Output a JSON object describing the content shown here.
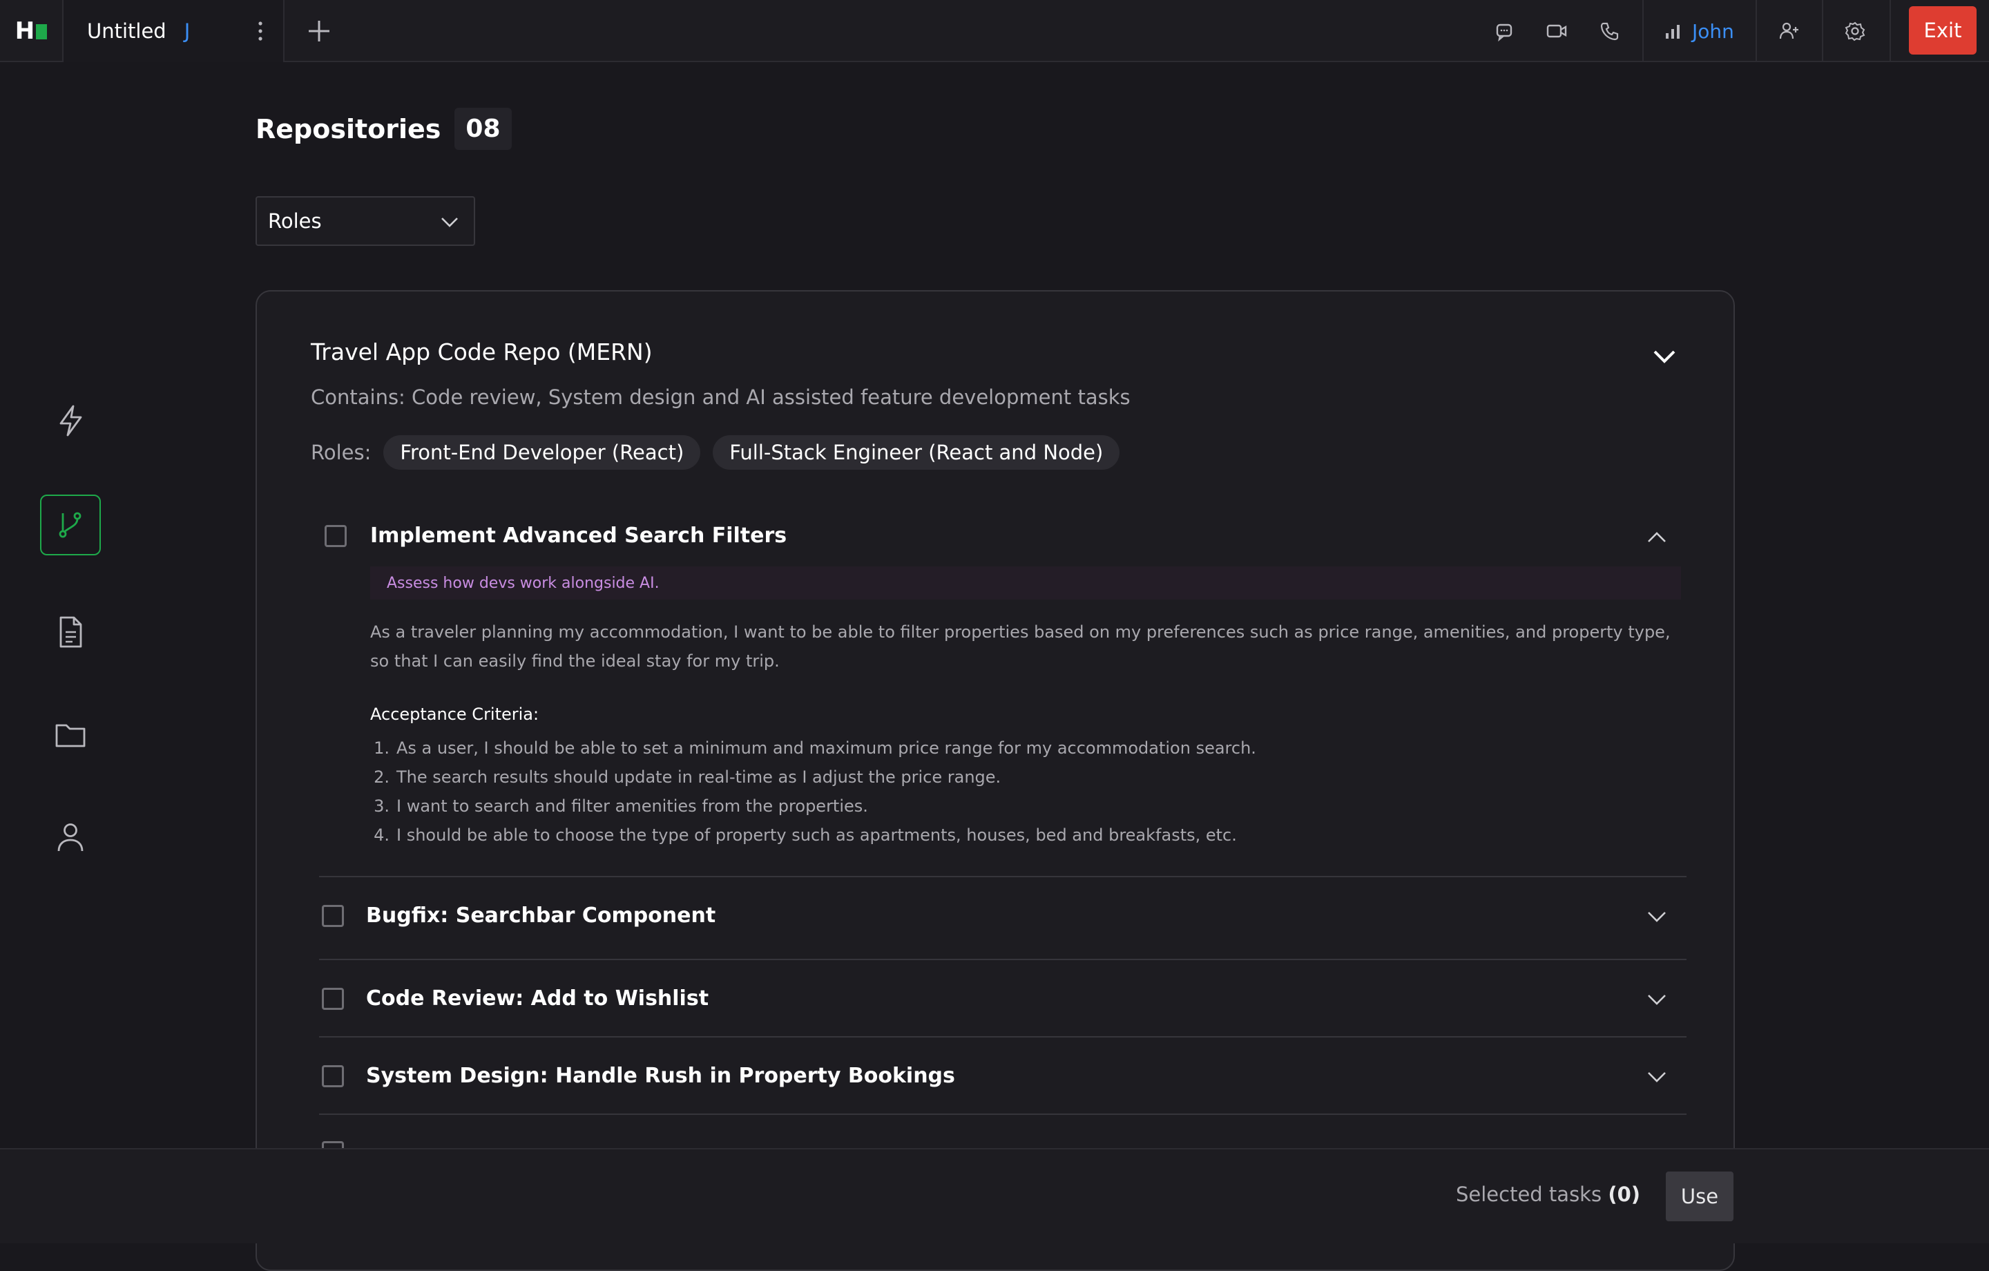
{
  "app": {
    "logo_letter": "H",
    "tab_title": "Untitled",
    "tab_initial": "J",
    "user_name": "John",
    "exit_label": "Exit"
  },
  "page": {
    "title": "Repositories",
    "count": "08",
    "roles_filter": "Roles"
  },
  "repo": {
    "title": "Travel App Code Repo (MERN)",
    "description": "Contains: Code review, System design and AI assisted feature development tasks",
    "roles_label": "Roles:",
    "roles": [
      "Front-End Developer (React)",
      "Full-Stack Engineer (React and Node)"
    ]
  },
  "tasks": [
    {
      "title": "Implement Advanced Search Filters",
      "expanded": true,
      "note": "Assess how devs work alongside AI.",
      "story": "As a traveler planning my accommodation, I want to be able to filter properties based on my preferences such as price range, amenities, and property type, so that I can easily find the ideal stay for my trip.",
      "criteria_heading": "Acceptance Criteria:",
      "criteria": [
        "As a user, I should be able to set a minimum and maximum price range for my accommodation search.",
        "The search results should update in real-time as I adjust the price range.",
        "I want to search and filter amenities from the properties.",
        "I should be able to choose the type of property such as apartments, houses, bed and breakfasts, etc."
      ]
    },
    {
      "title": "Bugfix: Searchbar Component",
      "expanded": false
    },
    {
      "title": "Code Review: Add to Wishlist",
      "expanded": false
    },
    {
      "title": "System Design: Handle Rush in Property Bookings",
      "expanded": false
    }
  ],
  "footer": {
    "selected_label": "Selected tasks",
    "selected_count": "(0)",
    "use_label": "Use"
  },
  "icons": {
    "top": [
      "chat-icon",
      "video-icon",
      "phone-icon",
      "signal-icon",
      "add-user-icon",
      "settings-icon"
    ],
    "sidebar": [
      "lightning-icon",
      "git-branch-icon",
      "document-icon",
      "folder-icon",
      "user-icon"
    ]
  },
  "colors": {
    "accent_green": "#1ea94a",
    "accent_blue": "#3b8ff6",
    "exit_red": "#de3d31",
    "ai_note_text": "#c98de2"
  }
}
